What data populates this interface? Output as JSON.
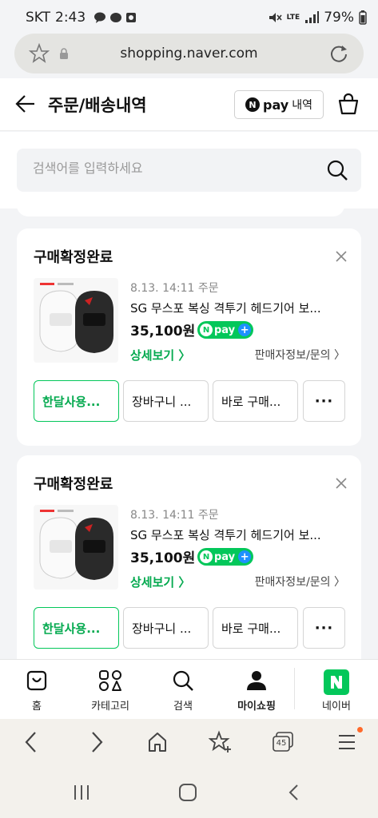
{
  "status_bar": {
    "carrier": "SKT",
    "time": "2:43",
    "network": "LTE",
    "battery": "79%"
  },
  "browser": {
    "url": "shopping.naver.com",
    "tab_count": "45"
  },
  "header": {
    "title": "주문/배송내역",
    "npay_label": "pay",
    "npay_history": "내역",
    "npay_n": "N"
  },
  "search": {
    "placeholder": "검색어를 입력하세요"
  },
  "orders": [
    {
      "status": "구매확정완료",
      "date": "8.13. 14:11 주문",
      "product_name": "SG 무스포 복싱 격투기 헤드기어 보...",
      "price": "35,100원",
      "npay_badge": "pay",
      "detail_link": "상세보기 〉",
      "seller_link": "판매자정보/문의 〉",
      "buttons": [
        "한달사용...",
        "장바구니 ...",
        "바로 구매...",
        "···"
      ]
    },
    {
      "status": "구매확정완료",
      "date": "8.13. 14:11 주문",
      "product_name": "SG 무스포 복싱 격투기 헤드기어 보...",
      "price": "35,100원",
      "npay_badge": "pay",
      "detail_link": "상세보기 〉",
      "seller_link": "판매자정보/문의 〉",
      "buttons": [
        "한달사용...",
        "장바구니 ...",
        "바로 구매...",
        "···"
      ]
    }
  ],
  "tabbar": [
    {
      "label": "홈",
      "icon": "shopping-bag-icon"
    },
    {
      "label": "카테고리",
      "icon": "category-grid-icon"
    },
    {
      "label": "검색",
      "icon": "search-icon"
    },
    {
      "label": "마이쇼핑",
      "icon": "person-icon"
    },
    {
      "label": "네이버",
      "icon": "naver-logo-icon"
    }
  ],
  "colors": {
    "accent": "#03c75a",
    "npay_plus": "#1e90ff"
  }
}
